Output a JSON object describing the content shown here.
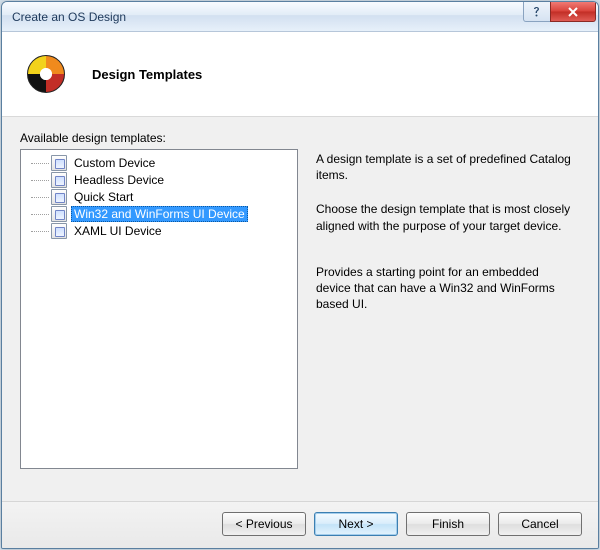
{
  "window": {
    "title": "Create an OS Design"
  },
  "header": {
    "heading": "Design Templates"
  },
  "main": {
    "available_label": "Available design templates:",
    "templates": [
      {
        "label": "Custom Device",
        "selected": false
      },
      {
        "label": "Headless Device",
        "selected": false
      },
      {
        "label": "Quick Start",
        "selected": false
      },
      {
        "label": "Win32 and WinForms UI Device",
        "selected": true
      },
      {
        "label": "XAML UI Device",
        "selected": false
      }
    ],
    "description": {
      "p1": "A design template is a set of predefined Catalog items.",
      "p2": "Choose the design template that is most closely aligned with the purpose of your target device.",
      "p3": "Provides a starting point for an embedded device that can have a Win32 and WinForms based UI."
    }
  },
  "buttons": {
    "previous": "< Previous",
    "next": "Next >",
    "finish": "Finish",
    "cancel": "Cancel"
  }
}
